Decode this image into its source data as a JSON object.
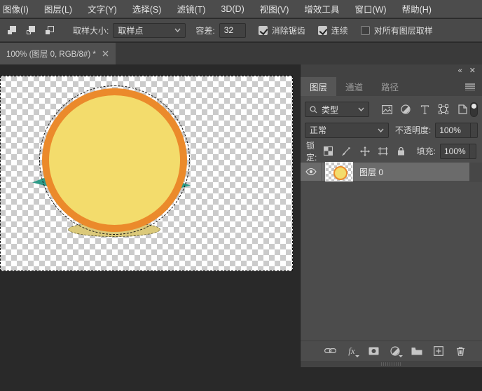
{
  "menu": {
    "items": [
      "图像(I)",
      "图层(L)",
      "文字(Y)",
      "选择(S)",
      "滤镜(T)",
      "3D(D)",
      "视图(V)",
      "增效工具",
      "窗口(W)",
      "帮助(H)"
    ]
  },
  "options": {
    "sample_size_label": "取样大小:",
    "sample_size_value": "取样点",
    "tolerance_label": "容差:",
    "tolerance_value": "32",
    "checkboxes": [
      {
        "label": "消除锯齿",
        "checked": true
      },
      {
        "label": "连续",
        "checked": true
      },
      {
        "label": "对所有图层取样",
        "checked": false
      }
    ]
  },
  "window": {
    "doc_tab_title": "100% (图层 0, RGB/8#) *"
  },
  "panel": {
    "tabs": [
      {
        "label": "图层"
      },
      {
        "label": "通道"
      },
      {
        "label": "路径"
      }
    ],
    "filter_type_label": "类型",
    "blend_mode": "正常",
    "opacity_label": "不透明度:",
    "opacity_value": "100%",
    "lock_label": "锁定:",
    "fill_label": "填充:",
    "fill_value": "100%",
    "layers": [
      {
        "name": "图层 0",
        "visible": true
      }
    ]
  },
  "colors": {
    "circle-ring": "#eb8a2b",
    "circle-fill": "#f3dc6c",
    "circle-shadow": "#dbc97a",
    "teal-accent": "#2e9b88",
    "panel-bg": "#4c4c4c",
    "pasteboard": "#292929",
    "selected-row": "#6b6b6b"
  }
}
